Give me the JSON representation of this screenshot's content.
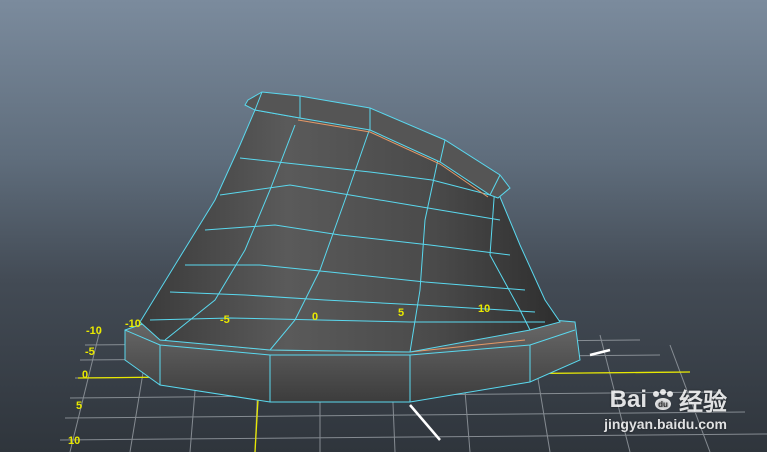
{
  "viewport": {
    "grid_labels_left": [
      "-10",
      "-5",
      "0",
      "5",
      "10"
    ],
    "grid_labels_model": [
      "-10",
      "-5",
      "0",
      "5",
      "10"
    ]
  },
  "watermark": {
    "brand_left": "Bai",
    "brand_right": "经验",
    "url": "jingyan.baidu.com"
  },
  "colors": {
    "wire": "#5ad8ee",
    "label": "#e8e800",
    "grid": "#9aa0a6"
  }
}
